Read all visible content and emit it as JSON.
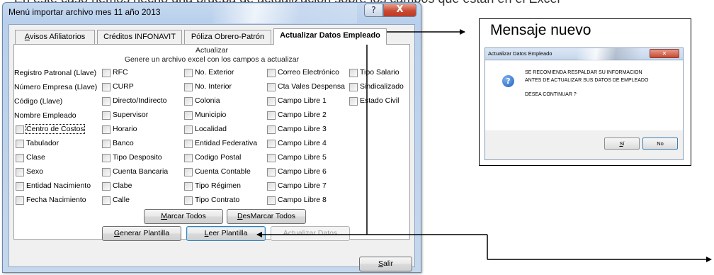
{
  "top_clipped_text": "En este caso hemos hecho una prueba de actualizacion sobre los campos que estan en el Excel",
  "window": {
    "title": "Menú importar archivo mes 11 año 2013",
    "help_glyph": "?",
    "close_glyph": "X"
  },
  "tabs": [
    {
      "label": "Avisos Afiliatorios",
      "mnemonic": "A",
      "rest": "visos Afiliatorios"
    },
    {
      "label": "Créditos INFONAVIT"
    },
    {
      "label": "Póliza Obrero-Patrón"
    },
    {
      "label": "Actualizar Datos Empleado",
      "active": true
    }
  ],
  "panel": {
    "heading": "Actualizar",
    "subheading": "Genere un archivo excel con los campos a actualizar"
  },
  "fields": {
    "col1": [
      "Registro Patronal (Llave)",
      "Número Empresa (Llave)",
      "Código (Llave)",
      "Nombre Empleado",
      "Centro de Costos",
      "Tabulador",
      "Clase",
      "Sexo",
      "Entidad Nacimiento",
      "Fecha Nacimiento"
    ],
    "col2": [
      "RFC",
      "CURP",
      "Directo/Indirecto",
      "Supervisor",
      "Horario",
      "Banco",
      "Tipo Desposito",
      "Cuenta Bancaria",
      "Clabe",
      "Calle"
    ],
    "col3": [
      "No. Exterior",
      "No. Interior",
      "Colonia",
      "Municipio",
      "Localidad",
      "Entidad Federativa",
      "Codigo Postal",
      "Cuenta Contable",
      "Tipo Régimen",
      "Tipo Contrato"
    ],
    "col4": [
      "Correo Electrónico",
      "Cta Vales Despensa",
      "Campo Libre 1",
      "Campo Libre 2",
      "Campo Libre 3",
      "Campo Libre 4",
      "Campo Libre 5",
      "Campo Libre 6",
      "Campo Libre 7",
      "Campo Libre 8"
    ],
    "col5": [
      "Tipo Salario",
      "Sindicalizado",
      "Estado Civil"
    ]
  },
  "buttons": {
    "marcar_todos": {
      "mnemonic": "M",
      "rest": "arcar Todos"
    },
    "desmarcar_todos": {
      "mnemonic": "D",
      "rest": "esMarcar Todos"
    },
    "generar_plantilla": {
      "mnemonic": "G",
      "rest": "enerar Plantilla"
    },
    "leer_plantilla": {
      "mnemonic": "L",
      "rest": "eer Plantilla"
    },
    "actualizar_datos": {
      "label": "Actualizar Datos"
    },
    "salir": {
      "mnemonic": "S",
      "rest": "alir"
    }
  },
  "callout": {
    "title": "Mensaje nuevo",
    "dialog_title": "Actualizar Datos Empleado",
    "dialog_icon": "?",
    "message_lines": [
      "SE RECOMIENDA RESPALDAR SU INFORMACION",
      "ANTES DE ACTUALIZAR SUS DATOS DE EMPLEADO",
      "DESEA CONTINUAR ?"
    ],
    "yes": {
      "mnemonic": "S",
      "rest": "í"
    },
    "no": "No"
  },
  "colors": {
    "window_frame": "#b9d0ec",
    "close_button": "#c94a33",
    "info_icon": "#1f5fbf"
  }
}
